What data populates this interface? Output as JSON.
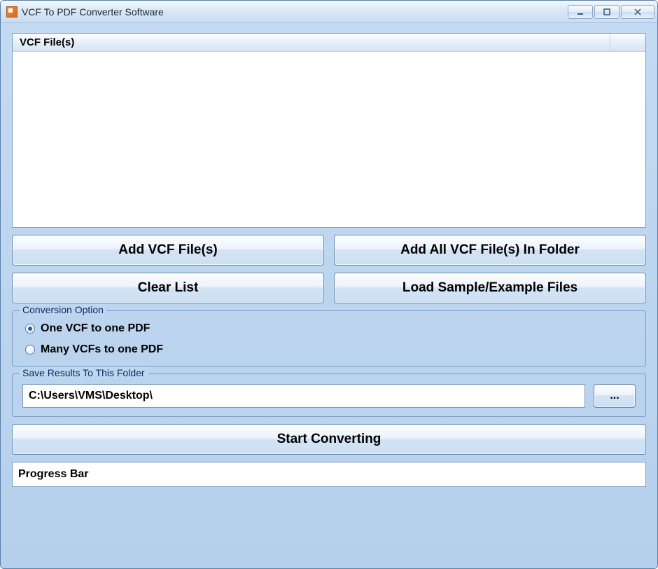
{
  "window": {
    "title": "VCF To PDF Converter Software"
  },
  "list": {
    "header": "VCF File(s)"
  },
  "buttons": {
    "add_files": "Add VCF File(s)",
    "add_folder": "Add All VCF File(s) In Folder",
    "clear_list": "Clear List",
    "load_sample": "Load Sample/Example Files",
    "browse": "...",
    "start": "Start Converting"
  },
  "conversion_option": {
    "legend": "Conversion Option",
    "options": [
      {
        "label": "One VCF to one PDF",
        "selected": true
      },
      {
        "label": "Many VCFs to one PDF",
        "selected": false
      }
    ]
  },
  "save_folder": {
    "legend": "Save Results To This Folder",
    "path": "C:\\Users\\VMS\\Desktop\\"
  },
  "progress": {
    "label": "Progress Bar"
  }
}
